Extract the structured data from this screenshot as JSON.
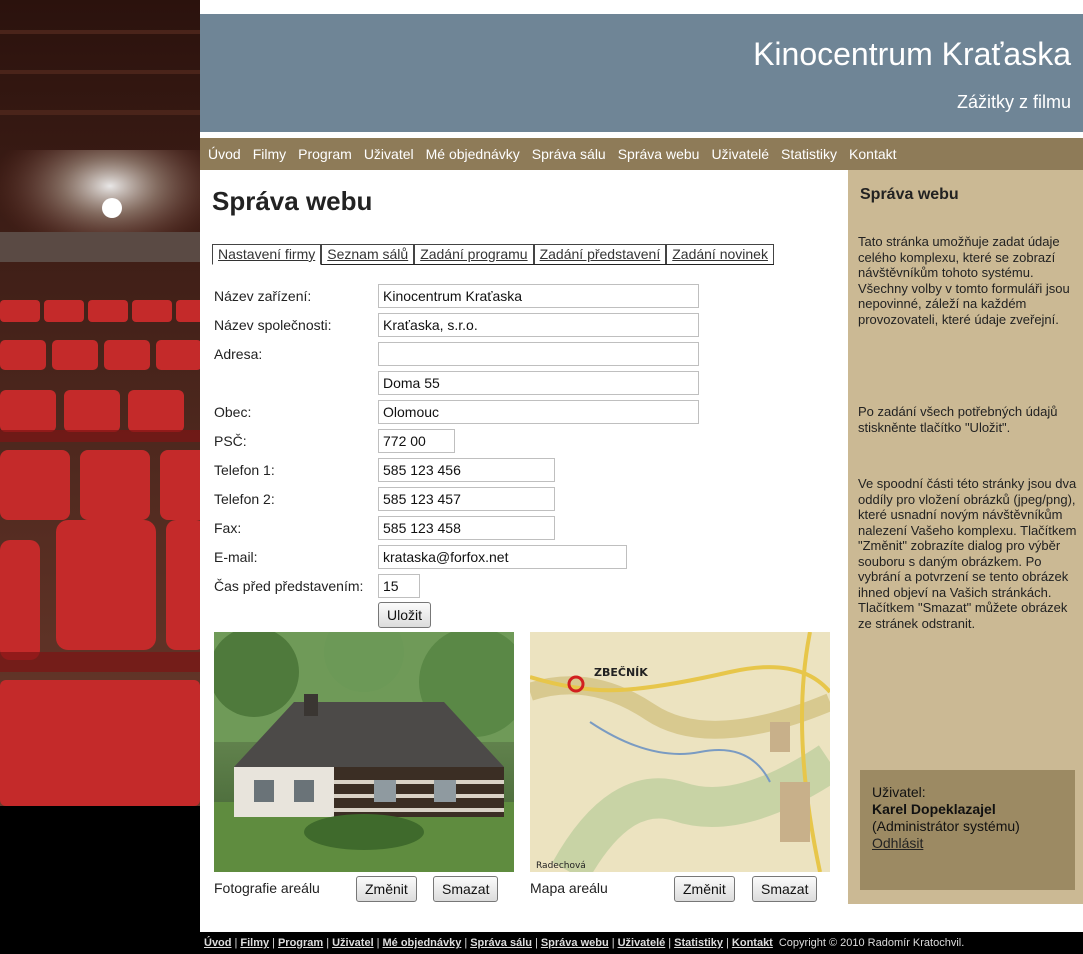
{
  "header": {
    "title": "Kinocentrum Kraťaska",
    "subtitle": "Zážitky z filmu"
  },
  "nav": [
    "Úvod",
    "Filmy",
    "Program",
    "Uživatel",
    "Mé objednávky",
    "Správa sálu",
    "Správa webu",
    "Uživatelé",
    "Statistiky",
    "Kontakt"
  ],
  "main": {
    "title": "Správa webu",
    "tabs": [
      "Nastavení firmy",
      "Seznam sálů",
      "Zadání programu",
      "Zadání představení",
      "Zadání novinek"
    ],
    "fields": {
      "nazev_zarizeni": {
        "label": "Název zařízení:",
        "value": "Kinocentrum Kraťaska"
      },
      "nazev_spolecnosti": {
        "label": "Název společnosti:",
        "value": "Kraťaska, s.r.o."
      },
      "adresa": {
        "label": "Adresa:",
        "value1": "",
        "value2": "Doma 55"
      },
      "obec": {
        "label": "Obec:",
        "value": "Olomouc"
      },
      "psc": {
        "label": "PSČ:",
        "value": "772 00"
      },
      "telefon1": {
        "label": "Telefon 1:",
        "value": "585 123 456"
      },
      "telefon2": {
        "label": "Telefon 2:",
        "value": "585 123 457"
      },
      "fax": {
        "label": "Fax:",
        "value": "585 123 458"
      },
      "email": {
        "label": "E-mail:",
        "value": "krataska@forfox.net"
      },
      "cas": {
        "label": "Čas před představením:",
        "value": "15"
      }
    },
    "save_label": "Uložit",
    "photo": {
      "caption": "Fotografie areálu",
      "change": "Změnit",
      "delete": "Smazat"
    },
    "map": {
      "caption": "Mapa areálu",
      "change": "Změnit",
      "delete": "Smazat",
      "place": "ZBEČNÍK",
      "place2": "Radechová"
    }
  },
  "sidebar": {
    "title": "Správa webu",
    "p1": "Tato stránka umožňuje zadat údaje celého komplexu, které se zobrazí návštěvníkům tohoto systému. Všechny volby v tomto formuláři jsou nepovinné, záleží na každém provozovateli, které údaje zveřejní.",
    "p2": "Po zadání všech potřebných údajů stiskněnte tlačítko \"Uložit\".",
    "p3": "Ve spoodní části této stránky jsou dva oddíly pro vložení obrázků (jpeg/png), které usnadní novým návštěvníkům nalezení Vašeho komplexu. Tlačítkem \"Změnit\" zobrazíte dialog pro výběr souboru s daným obrázkem. Po vybrání a potvrzení se tento obrázek ihned objeví na Vašich stránkách. Tlačítkem \"Smazat\" můžete obrázek ze stránek odstranit.",
    "user_label": "Uživatel:",
    "user_name": "Karel Dopeklazajel",
    "user_role": "(Administrátor systému)",
    "logout": "Odhlásit"
  },
  "footer": {
    "links": [
      "Úvod",
      "Filmy",
      "Program",
      "Uživatel",
      "Mé objednávky",
      "Správa sálu",
      "Správa webu",
      "Uživatelé",
      "Statistiky",
      "Kontakt"
    ],
    "copyright": "Copyright © 2010 Radomír Kratochvil."
  }
}
